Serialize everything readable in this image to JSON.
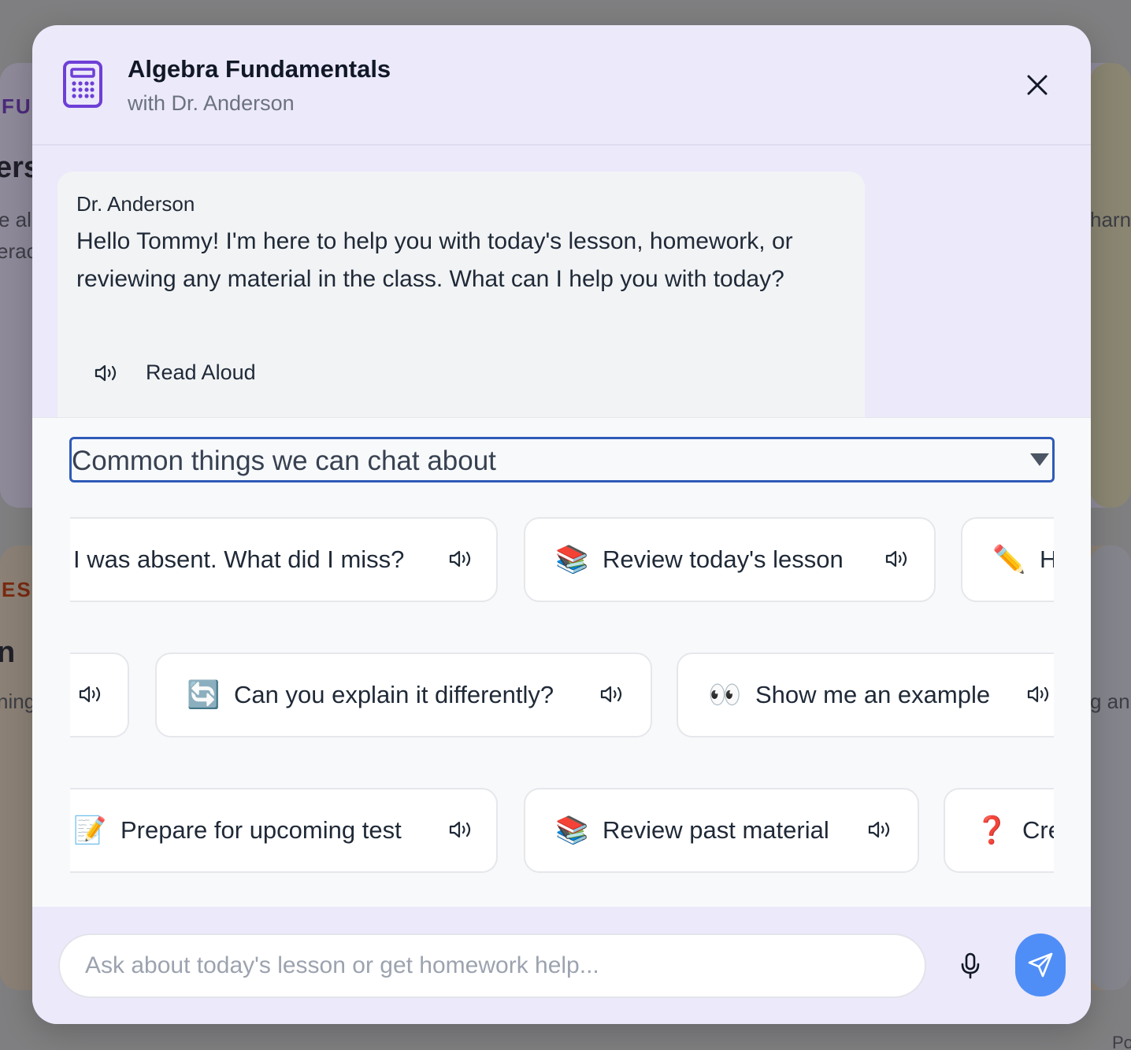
{
  "background": {
    "fragments": [
      "FU",
      "ers",
      "e alg",
      "erac",
      "ES",
      "n",
      "ning",
      "harn",
      "g an",
      "Po"
    ]
  },
  "modal": {
    "title": "Algebra Fundamentals",
    "subtitle": "with Dr. Anderson",
    "icon": "calculator-icon",
    "close_icon": "close-icon"
  },
  "chat": {
    "messages": [
      {
        "sender": "Dr. Anderson",
        "text": "Hello Tommy! I'm here to help you with today's lesson, homework, or reviewing any material in the class. What can I help you with today?",
        "read_aloud_label": "Read Aloud"
      }
    ]
  },
  "suggestions": {
    "select_label": "Common things we can chat about",
    "rows": [
      [
        {
          "emoji": "",
          "label": "I was absent. What did I miss?"
        },
        {
          "emoji": "📚",
          "label": "Review today's lesson"
        },
        {
          "emoji": "✏️",
          "label": "H"
        }
      ],
      [
        {
          "emoji": "",
          "label": ""
        },
        {
          "emoji": "🔄",
          "label": "Can you explain it differently?"
        },
        {
          "emoji": "👀",
          "label": "Show me an example"
        }
      ],
      [
        {
          "emoji": "📝",
          "label": "Prepare for upcoming test"
        },
        {
          "emoji": "📚",
          "label": "Review past material"
        },
        {
          "emoji": "❓",
          "label": "Cre"
        }
      ]
    ]
  },
  "composer": {
    "placeholder": "Ask about today's lesson or get homework help...",
    "value": "",
    "mic_icon": "microphone-icon",
    "send_icon": "send-icon"
  },
  "colors": {
    "modal_bg": "#ece9fb",
    "accent_purple": "#6d3fd6",
    "send_button": "#4f8ef7",
    "select_border": "#2f5bb7"
  }
}
